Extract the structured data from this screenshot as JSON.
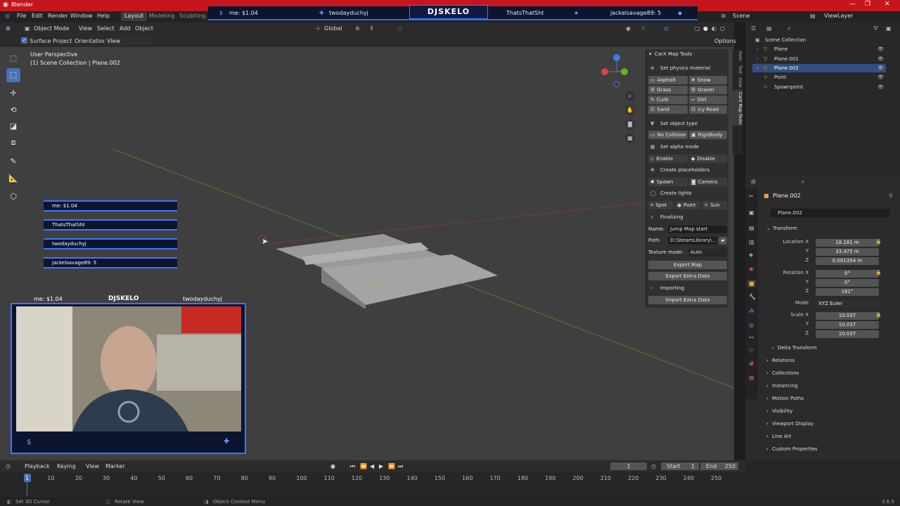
{
  "app": {
    "title": "Blender"
  },
  "menu": [
    "File",
    "Edit",
    "Render",
    "Window",
    "Help"
  ],
  "workspaces": [
    "Layout",
    "Modeling",
    "Sculpting"
  ],
  "overlay": {
    "items": [
      "me: $1.04",
      "twodayduchyj",
      "ThatsThatSht",
      "jackelsavage89: 5"
    ],
    "brand": "DJSKELO"
  },
  "scene": {
    "scene_name": "Scene",
    "view_layer": "ViewLayer"
  },
  "viewport_header": {
    "mode": "Object Mode",
    "menus": [
      "View",
      "Select",
      "Add",
      "Object"
    ],
    "transform": "Global",
    "surface_project": "Surface Project",
    "orientation_label": "Orientation:",
    "orientation_value": "View",
    "options": "Options"
  },
  "viewport_info": {
    "line1": "User Perspective",
    "line2": "(1) Scene Collection | Plane.002"
  },
  "npanel": {
    "title": "CarX Map Tools",
    "physics": {
      "label": "Set physics material",
      "buttons": [
        "Asphalt",
        "Snow",
        "Grass",
        "Gravel",
        "Curb",
        "Dirt",
        "Sand",
        "Icy Road"
      ]
    },
    "object_type": {
      "label": "Set object type",
      "buttons": [
        "No Collision",
        "Rigidbody"
      ]
    },
    "alpha": {
      "label": "Set alpha mode",
      "buttons": [
        "Enable",
        "Disable"
      ]
    },
    "placeholders": {
      "label": "Create placeholders",
      "buttons": [
        "Spawn",
        "Camera"
      ]
    },
    "lights": {
      "label": "Create lights",
      "buttons": [
        "Spot",
        "Point",
        "Sun"
      ]
    },
    "finalizing": {
      "label": "Finalizing",
      "name_label": "Name:",
      "name_value": "Jump Map start",
      "path_label": "Path:",
      "path_value": "D:\\SteamLibrary\\...",
      "texture_label": "Texture mode:",
      "texture_value": "Auto",
      "export_map": "Export Map",
      "export_extra": "Export Extra Data"
    },
    "importing": {
      "label": "Importing",
      "import_extra": "Import Extra Data"
    }
  },
  "npanel_tabs": [
    "Item",
    "Tool",
    "View",
    "CarX Map Tools"
  ],
  "outliner": {
    "root": "Scene Collection",
    "items": [
      "Plane",
      "Plane.001",
      "Plane.002",
      "Point",
      "Spawnpoint"
    ]
  },
  "properties": {
    "object_name": "Plane.002",
    "section": "Transform",
    "location": {
      "label": "Location X",
      "x": "18.181 m",
      "y": "33.475 m",
      "z": "0.001354 m"
    },
    "rotation": {
      "label": "Rotation X",
      "x": "0°",
      "y": "0°",
      "z": "181°"
    },
    "mode_label": "Mode",
    "mode_value": "XYZ Euler",
    "scale": {
      "label": "Scale X",
      "x": "10.037",
      "y": "10.037",
      "z": "10.037"
    },
    "axis_y": "Y",
    "axis_z": "Z",
    "collapsed": [
      "Delta Transform",
      "Relations",
      "Collections",
      "Instancing",
      "Motion Paths",
      "Visibility",
      "Viewport Display",
      "Line Art",
      "Custom Properties"
    ]
  },
  "timeline": {
    "menus": [
      "Playback",
      "Keying",
      "View",
      "Marker"
    ],
    "current_frame": "1",
    "start_label": "Start",
    "start": "1",
    "end_label": "End",
    "end": "250",
    "ticks": [
      "1",
      "10",
      "20",
      "30",
      "40",
      "50",
      "60",
      "70",
      "80",
      "90",
      "100",
      "110",
      "120",
      "130",
      "140",
      "150",
      "160",
      "170",
      "180",
      "190",
      "200",
      "210",
      "220",
      "230",
      "240",
      "250"
    ]
  },
  "statusbar": {
    "items": [
      "Set 3D Cursor",
      "Rotate View",
      "Object Context Menu"
    ],
    "version": "3.6.5"
  },
  "colors": {
    "accent": "#4772b3",
    "title_red": "#c4161c",
    "stream_blue": "#3b77ff"
  }
}
